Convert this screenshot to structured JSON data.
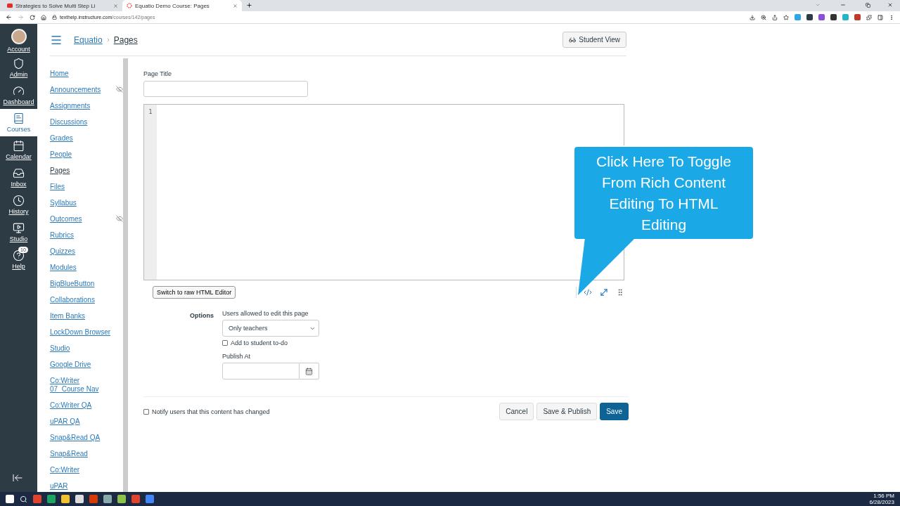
{
  "browser": {
    "tabs": [
      {
        "title": "Strategies to Solve Multi Step Li",
        "selected": false,
        "kind": "video"
      },
      {
        "title": "Equatio Demo Course: Pages",
        "selected": true,
        "kind": "course"
      }
    ],
    "url": {
      "host": "texthelp.instructure.com",
      "path": "/courses/142/pages"
    }
  },
  "global_nav": {
    "items": [
      {
        "label": "Account",
        "selected": false
      },
      {
        "label": "Admin",
        "selected": false
      },
      {
        "label": "Dashboard",
        "selected": false
      },
      {
        "label": "Courses",
        "selected": true
      },
      {
        "label": "Calendar",
        "selected": false
      },
      {
        "label": "Inbox",
        "selected": false
      },
      {
        "label": "History",
        "selected": false
      },
      {
        "label": "Studio",
        "selected": false
      },
      {
        "label": "Help",
        "selected": false,
        "badge": "10"
      }
    ]
  },
  "breadcrumb": [
    "Equatio",
    "Pages"
  ],
  "student_view_button": "Student View",
  "course_nav": {
    "items": [
      {
        "label": "Home",
        "selected": false,
        "hidden": false
      },
      {
        "label": "Announcements",
        "selected": false,
        "hidden": true
      },
      {
        "label": "Assignments",
        "selected": false,
        "hidden": false
      },
      {
        "label": "Discussions",
        "selected": false,
        "hidden": false
      },
      {
        "label": "Grades",
        "selected": false,
        "hidden": false
      },
      {
        "label": "People",
        "selected": false,
        "hidden": false
      },
      {
        "label": "Pages",
        "selected": true,
        "hidden": false
      },
      {
        "label": "Files",
        "selected": false,
        "hidden": false
      },
      {
        "label": "Syllabus",
        "selected": false,
        "hidden": false
      },
      {
        "label": "Outcomes",
        "selected": false,
        "hidden": true
      },
      {
        "label": "Rubrics",
        "selected": false,
        "hidden": false
      },
      {
        "label": "Quizzes",
        "selected": false,
        "hidden": false
      },
      {
        "label": "Modules",
        "selected": false,
        "hidden": false
      },
      {
        "label": "BigBlueButton",
        "selected": false,
        "hidden": false
      },
      {
        "label": "Collaborations",
        "selected": false,
        "hidden": false
      },
      {
        "label": "Item Banks",
        "selected": false,
        "hidden": false
      },
      {
        "label": "LockDown Browser",
        "selected": false,
        "hidden": false
      },
      {
        "label": "Studio",
        "selected": false,
        "hidden": false
      },
      {
        "label": "Google Drive",
        "selected": false,
        "hidden": false
      },
      {
        "label": "Co:Writer 07_Course Nav",
        "selected": false,
        "hidden": false
      },
      {
        "label": "Co:Writer QA",
        "selected": false,
        "hidden": false
      },
      {
        "label": "uPAR QA",
        "selected": false,
        "hidden": false
      },
      {
        "label": "Snap&Read QA",
        "selected": false,
        "hidden": false
      },
      {
        "label": "Snap&Read",
        "selected": false,
        "hidden": false
      },
      {
        "label": "Co:Writer",
        "selected": false,
        "hidden": false
      },
      {
        "label": "uPAR",
        "selected": false,
        "hidden": false
      }
    ]
  },
  "editor": {
    "page_title_label": "Page Title",
    "line_number": "1",
    "switch_button": "Switch to raw HTML Editor"
  },
  "options": {
    "label": "Options",
    "users_label": "Users allowed to edit this page",
    "users_value": "Only teachers",
    "todo": {
      "label": "Add to student to-do",
      "checked": false
    },
    "publish_at_label": "Publish At"
  },
  "notify": {
    "label": "Notify users that this content has changed",
    "checked": false
  },
  "buttons": [
    {
      "label": "Cancel",
      "kind": "default"
    },
    {
      "label": "Save & Publish",
      "kind": "default"
    },
    {
      "label": "Save",
      "kind": "primary"
    }
  ],
  "callout": "Click Here To Toggle From Rich Content Editing To HTML Editing",
  "taskbar": {
    "time": "1:56 PM",
    "date": "6/28/2023"
  }
}
